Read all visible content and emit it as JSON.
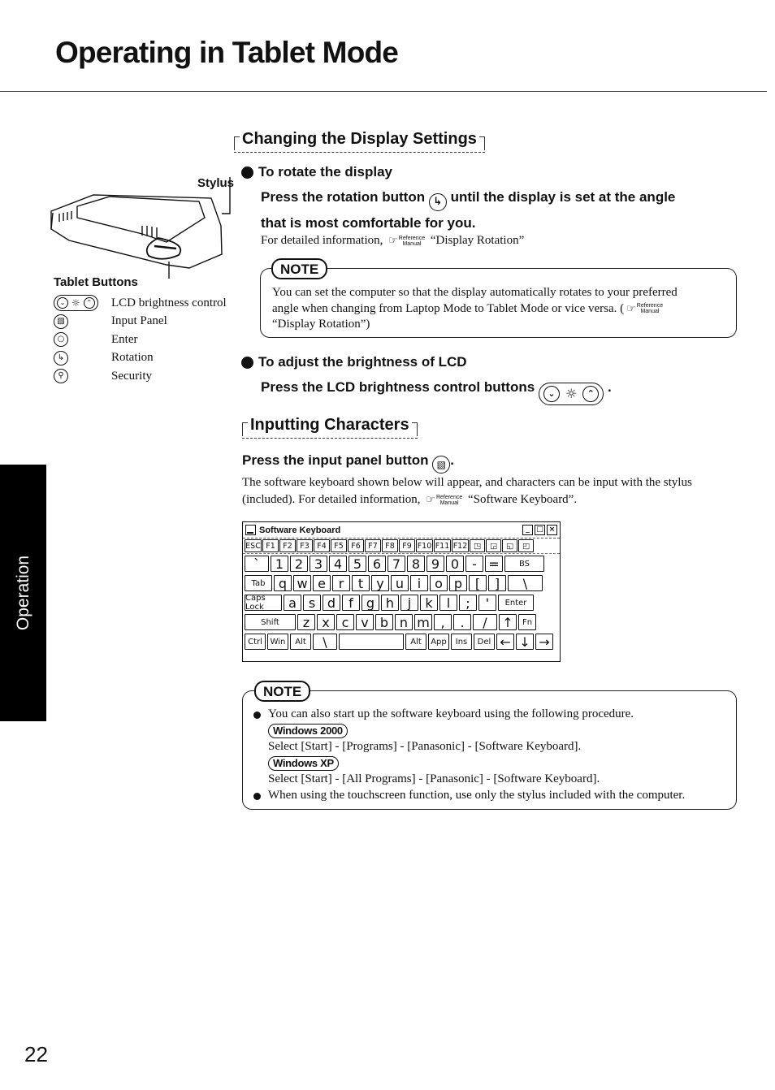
{
  "page": {
    "title": "Operating in Tablet Mode",
    "side_tab": "Operation",
    "page_number": "22"
  },
  "left_column": {
    "stylus_label": "Stylus",
    "tablet_buttons_heading": "Tablet Buttons",
    "tablet_buttons": [
      {
        "icon": "lcd-brightness-buttons-icon",
        "label": "LCD brightness control"
      },
      {
        "icon": "input-panel-button-icon",
        "label": "Input Panel"
      },
      {
        "icon": "enter-button-icon",
        "label": "Enter"
      },
      {
        "icon": "rotation-button-icon",
        "label": "Rotation"
      },
      {
        "icon": "security-button-icon",
        "label": "Security"
      }
    ]
  },
  "display_settings": {
    "heading": "Changing the Display Settings",
    "rotate": {
      "heading": "To rotate the display",
      "instruction_before": "Press the rotation button",
      "instruction_after": "until the display is set at the angle",
      "instruction_line2": "that is most comfortable for you.",
      "detail_prefix": "For detailed information,",
      "detail_ref": "“Display Rotation”"
    },
    "note": {
      "label": "NOTE",
      "text_line1": "You can set the computer so that the display automatically rotates to your preferred",
      "text_line2": "angle when changing from Laptop Mode to Tablet Mode or vice versa.",
      "text_line3": "“Display Rotation”)"
    },
    "brightness": {
      "heading": "To adjust the brightness of LCD",
      "instruction": "Press the LCD brightness control buttons"
    }
  },
  "reference_manual": {
    "line1": "Reference",
    "line2": "Manual",
    "hand_glyph": "☞"
  },
  "inputting": {
    "heading": "Inputting Characters",
    "instruction": "Press the input panel button",
    "body_line1": "The software keyboard shown below will appear, and characters can be input with the stylus",
    "body_line2_prefix": "(included).  For detailed information,",
    "body_ref": "“Software Keyboard”."
  },
  "software_keyboard": {
    "title": "Software Keyboard",
    "window_buttons": {
      "minimize": "_",
      "maximize": "□",
      "close": "×"
    },
    "rows": [
      [
        "ESC",
        "F1",
        "F2",
        "F3",
        "F4",
        "F5",
        "F6",
        "F7",
        "F8",
        "F9",
        "F10",
        "F11",
        "F12",
        "◳",
        "◲",
        "◱",
        "◰"
      ],
      [
        "`",
        "1",
        "2",
        "3",
        "4",
        "5",
        "6",
        "7",
        "8",
        "9",
        "0",
        "-",
        "=",
        "BS"
      ],
      [
        "Tab",
        "q",
        "w",
        "e",
        "r",
        "t",
        "y",
        "u",
        "i",
        "o",
        "p",
        "[",
        "]",
        "\\"
      ],
      [
        "Caps Lock",
        "a",
        "s",
        "d",
        "f",
        "g",
        "h",
        "j",
        "k",
        "l",
        ";",
        "'",
        "Enter"
      ],
      [
        "Shift",
        "z",
        "x",
        "c",
        "v",
        "b",
        "n",
        "m",
        ",",
        ".",
        "/",
        "↑",
        "Fn"
      ],
      [
        "Ctrl",
        "Win",
        "Alt",
        "\\",
        "",
        "Alt",
        "App",
        "Ins",
        "Del",
        "←",
        "↓",
        "→"
      ]
    ]
  },
  "note2": {
    "label": "NOTE",
    "item1": "You can also start up the software keyboard using the following procedure.",
    "win2000_badge": "Windows 2000",
    "win2000_step": "Select [Start] - [Programs] - [Panasonic] - [Software Keyboard].",
    "winxp_badge": "Windows XP",
    "winxp_step": "Select [Start] - [All Programs] - [Panasonic] - [Software Keyboard].",
    "item2": "When using the touchscreen function, use only the stylus included with the computer."
  }
}
